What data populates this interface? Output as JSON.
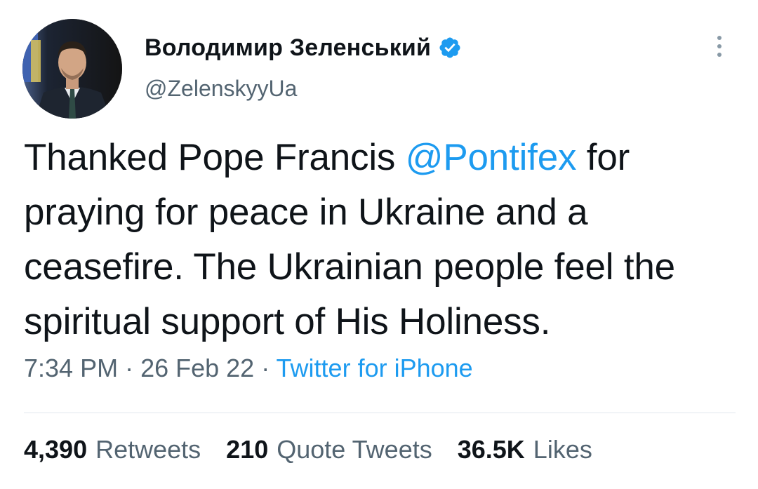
{
  "author": {
    "display_name": "Володимир Зеленський",
    "handle": "@ZelenskyyUa",
    "verified": true,
    "avatar_icon": "profile-photo",
    "verified_color": "#1d9bf0"
  },
  "tweet": {
    "text_before": "Thanked Pope Francis ",
    "mention": "@Pontifex",
    "text_after": " for praying for peace in Ukraine and a ceasefire. The Ukrainian people feel the spiritual support of His Holiness."
  },
  "meta": {
    "time": "7:34 PM",
    "separator1": " · ",
    "date": "26 Feb 22",
    "separator2": " · ",
    "source": "Twitter for iPhone"
  },
  "stats": {
    "retweets_count": "4,390",
    "retweets_label": "Retweets",
    "quotes_count": "210",
    "quotes_label": "Quote Tweets",
    "likes_count": "36.5K",
    "likes_label": "Likes"
  },
  "colors": {
    "accent": "#1d9bf0",
    "text": "#0f1419",
    "secondary": "#536471",
    "divider": "#e1e8ed"
  },
  "icons": {
    "more": "more-vertical-icon",
    "verified": "verified-badge-icon"
  }
}
